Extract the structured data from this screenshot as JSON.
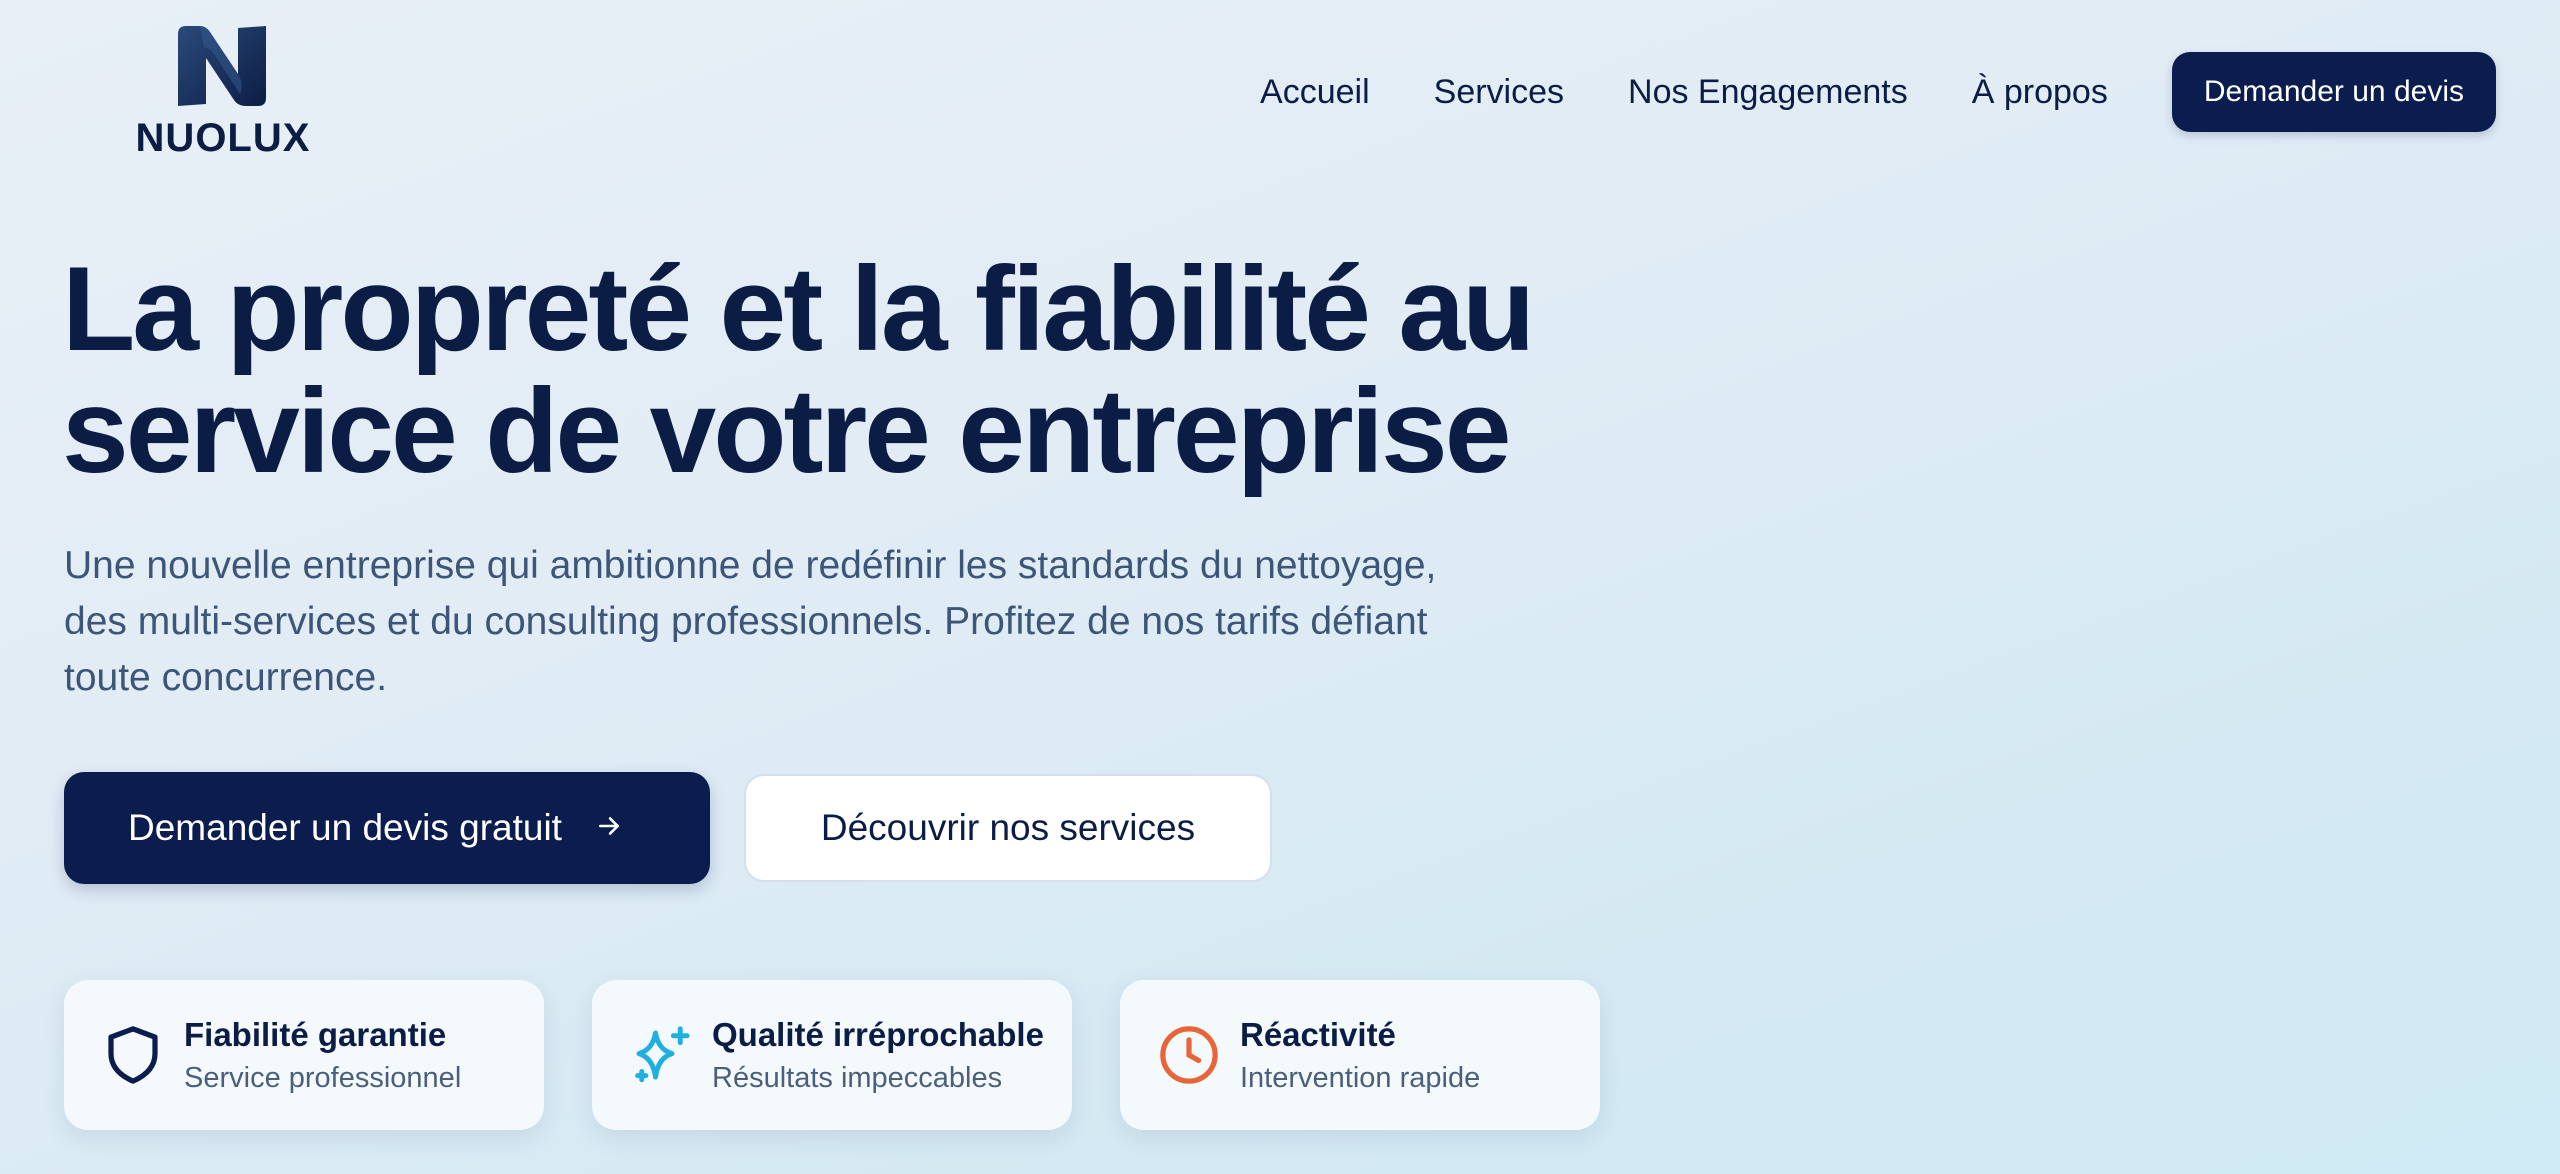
{
  "brand": {
    "name": "NUOLUX",
    "logo_icon": "n-logo-icon",
    "primary_color": "#0b1d4f"
  },
  "nav": {
    "links": [
      "Accueil",
      "Services",
      "Nos Engagements",
      "À propos"
    ],
    "cta_label": "Demander un devis"
  },
  "hero": {
    "title_line1": "La propreté et la fiabilité au",
    "title_line2": "service de votre entreprise",
    "subtitle": "Une nouvelle entreprise qui ambitionne de redéfinir les standards du nettoyage, des multi-services et du consulting professionnels. Profitez de nos tarifs défiant toute concurrence.",
    "primary_button": "Demander un devis gratuit",
    "primary_button_icon": "arrow-right-icon",
    "secondary_button": "Découvrir nos services"
  },
  "features": [
    {
      "title": "Fiabilité garantie",
      "subtitle": "Service professionnel",
      "icon": "shield-icon",
      "color": "#0b1d4f"
    },
    {
      "title": "Qualité irréprochable",
      "subtitle": "Résultats impeccables",
      "icon": "sparkles-icon",
      "color": "#1fb0e0"
    },
    {
      "title": "Réactivité",
      "subtitle": "Intervention rapide",
      "icon": "clock-icon",
      "color": "#e8653a"
    }
  ]
}
